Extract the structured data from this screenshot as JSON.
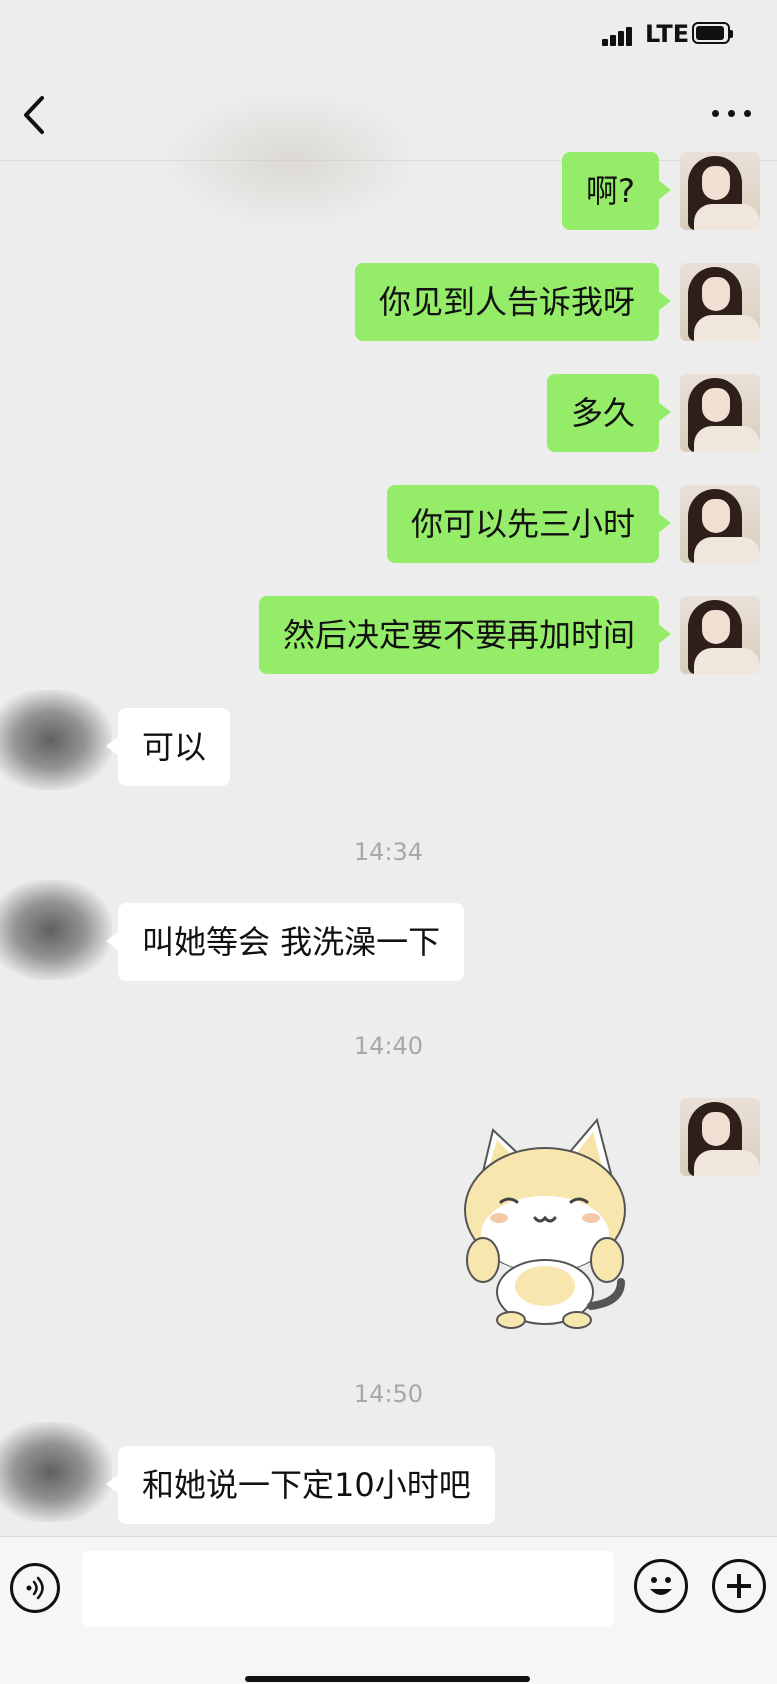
{
  "status_bar": {
    "network": "LTE",
    "signal_bars": 4,
    "battery_level": 0.85
  },
  "navbar": {
    "back_icon": "chevron-left-icon",
    "more_icon": "more-dots-icon"
  },
  "messages": [
    {
      "side": "sent",
      "text": "啊?"
    },
    {
      "side": "sent",
      "text": "你见到人告诉我呀"
    },
    {
      "side": "sent",
      "text": "多久"
    },
    {
      "side": "sent",
      "text": "你可以先三小时"
    },
    {
      "side": "sent",
      "text": "然后决定要不要再加时间"
    },
    {
      "side": "received",
      "text": "可以"
    },
    {
      "type": "time",
      "text": "14:34"
    },
    {
      "side": "received",
      "text": "叫她等会 我洗澡一下"
    },
    {
      "type": "time",
      "text": "14:40"
    },
    {
      "side": "sent",
      "type": "sticker",
      "sticker": "cat-sticker"
    },
    {
      "type": "time",
      "text": "14:50"
    },
    {
      "side": "received",
      "text": "和她说一下定10小时吧"
    }
  ],
  "input_bar": {
    "voice_icon": "voice-icon",
    "emoji_icon": "emoji-icon",
    "plus_icon": "plus-icon",
    "text_value": ""
  }
}
